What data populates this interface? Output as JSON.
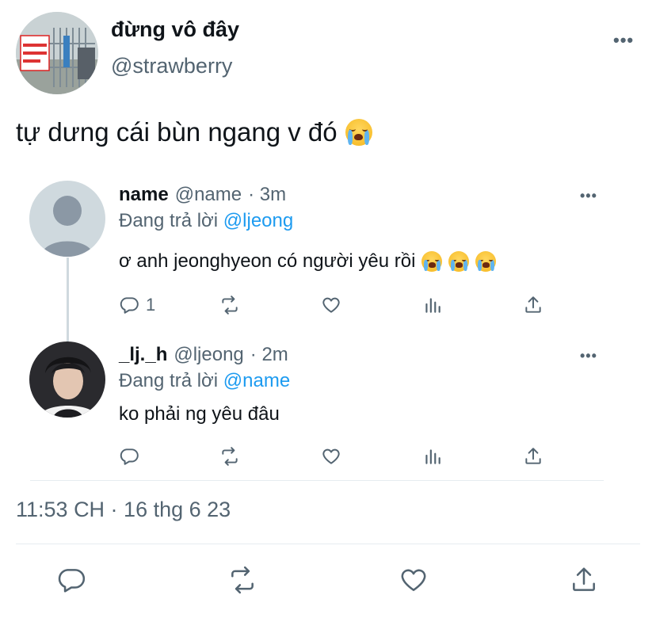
{
  "tweet": {
    "author_name": "đừng vô đây",
    "author_handle": "@strawberry",
    "text": "tự dưng cái bùn ngang v đó",
    "text_emoji": "loudly-crying-face",
    "timestamp": "11:53 CH · 16 thg 6 23",
    "avatar_sign_text": "KHÔNG TIẾP NGƯỜI XÀM L",
    "more_label": "•••"
  },
  "replies": [
    {
      "name": "name",
      "handle": "@name",
      "time": "· 3m",
      "replying_prefix": "Đang trả lời",
      "replying_to": "@ljeong",
      "text": "ơ anh jeonghyeon có người yêu rồi",
      "emoji_count": 3,
      "reply_count": "1",
      "more_label": "•••"
    },
    {
      "name": "_lj._h",
      "handle": "@ljeong",
      "time": "· 2m",
      "replying_prefix": "Đang trả lời",
      "replying_to": "@name",
      "text": "ko phải ng yêu đâu",
      "reply_count": "",
      "more_label": "•••"
    }
  ],
  "colors": {
    "text": "#0f1419",
    "secondary": "#536471",
    "link": "#1d9bf0",
    "divider": "#e6ecf0"
  },
  "icons": [
    "reply-icon",
    "retweet-icon",
    "like-icon",
    "analytics-icon",
    "share-icon",
    "more-icon"
  ]
}
